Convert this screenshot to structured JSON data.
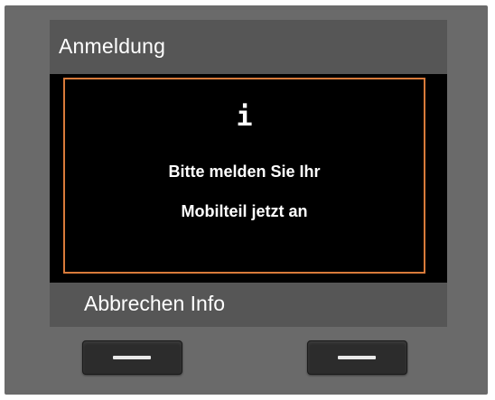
{
  "screen": {
    "title": "Anmeldung"
  },
  "message": {
    "icon": "info-icon",
    "icon_glyph": "i",
    "line1": "Bitte melden Sie Ihr",
    "line2": "Mobilteil jetzt an"
  },
  "softkeys": {
    "labels": "Abbrechen Info",
    "left_label": "Abbrechen",
    "right_label": "Info"
  },
  "colors": {
    "frame": "#6a6a6a",
    "screen_bars": "#565656",
    "screen_bg": "#000000",
    "message_border": "#d87a3a"
  }
}
